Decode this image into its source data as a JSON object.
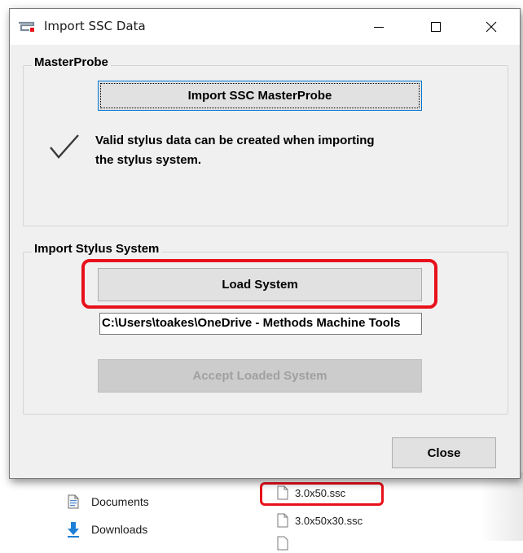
{
  "dialog": {
    "title": "Import SSC Data",
    "masterprobe_group": {
      "legend": "MasterProbe",
      "import_button": "Import SSC MasterProbe",
      "message_line1": "Valid stylus data can be created when importing",
      "message_line2": "the stylus system."
    },
    "stylus_group": {
      "legend": "Import Stylus System",
      "load_button": "Load System",
      "path_value": "C:\\Users\\toakes\\OneDrive - Methods Machine Tools",
      "accept_button": "Accept Loaded System"
    },
    "close_button": "Close"
  },
  "explorer": {
    "nav": [
      {
        "label": "Documents",
        "icon": "documents-icon"
      },
      {
        "label": "Downloads",
        "icon": "downloads-icon"
      }
    ],
    "files": [
      {
        "label": "3.0x50.ssc",
        "highlighted": true
      },
      {
        "label": "3.0x50x30.ssc",
        "highlighted": false
      }
    ]
  },
  "colors": {
    "highlight": "#e8101a",
    "dialog_bg": "#f0f0f0",
    "download_arrow": "#1e7fd6"
  }
}
